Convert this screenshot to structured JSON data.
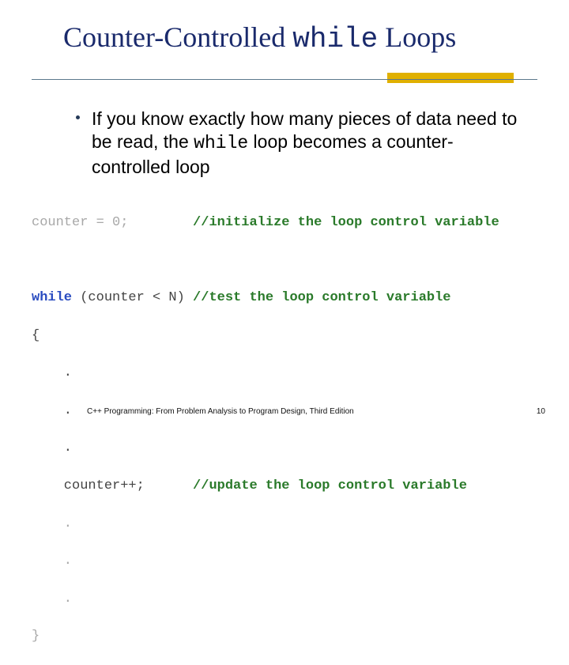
{
  "title": {
    "p1": "Counter-Controlled ",
    "kw": "while",
    "p2": " Loops"
  },
  "bullet": {
    "p1": "If you know exactly how many pieces of data need to be read, the ",
    "kw": "while",
    "p2": " loop becomes a counter-controlled loop"
  },
  "code": {
    "l1a": "counter = 0;        ",
    "l1c": "//initialize the loop control variable",
    "blank": " ",
    "l2k": "while",
    "l2a": " (counter < N) ",
    "l2c": "//test the loop control variable",
    "l3": "{",
    "l4": "    .",
    "l5": "    .",
    "l6": "    .",
    "l7a": "    counter++;      ",
    "l7c": "//update the loop control variable",
    "l8": "    .",
    "l9": "    .",
    "l10": "    .",
    "l11": "}"
  },
  "footer": {
    "text": "C++ Programming: From Problem Analysis to Program Design, Third Edition",
    "page": "10"
  }
}
